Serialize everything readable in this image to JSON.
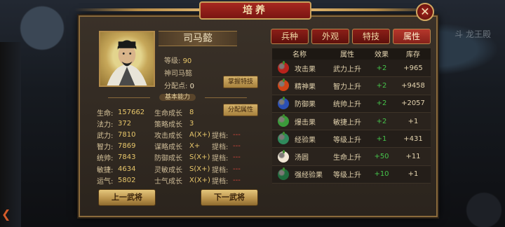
{
  "window": {
    "title": "培养",
    "close_glyph": "✕"
  },
  "background": {
    "corner_text": "斗 龙王殿"
  },
  "general": {
    "name": "司马懿",
    "level_label": "等级:",
    "level_value": "90",
    "title": "神司马懿",
    "points_label": "分配点:",
    "points_value": "0"
  },
  "buttons": {
    "master_skill": "掌握特技",
    "allocate_attr": "分配属性",
    "prev_general": "上一武将",
    "next_general": "下一武将"
  },
  "section_label": "基本能力",
  "stats": [
    {
      "label": "生命:",
      "value": "157662",
      "growth_label": "生命成长",
      "growth_value": "8",
      "boost_label": "",
      "boost_value": ""
    },
    {
      "label": "法力:",
      "value": "372",
      "growth_label": "策略成长",
      "growth_value": "3",
      "boost_label": "",
      "boost_value": ""
    },
    {
      "label": "武力:",
      "value": "7810",
      "growth_label": "攻击成长",
      "growth_value": "A(X+)",
      "boost_label": "提档:",
      "boost_value": "---"
    },
    {
      "label": "智力:",
      "value": "7869",
      "growth_label": "谋略成长",
      "growth_value": "X+",
      "boost_label": "提档:",
      "boost_value": "---"
    },
    {
      "label": "统帅:",
      "value": "7843",
      "growth_label": "防御成长",
      "growth_value": "S(X+)",
      "boost_label": "提档:",
      "boost_value": "---"
    },
    {
      "label": "敏捷:",
      "value": "4634",
      "growth_label": "灵敏成长",
      "growth_value": "S(X+)",
      "boost_label": "提档:",
      "boost_value": "---"
    },
    {
      "label": "运气:",
      "value": "5802",
      "growth_label": "士气成长",
      "growth_value": "X(X+)",
      "boost_label": "提档:",
      "boost_value": "---"
    }
  ],
  "tabs": [
    {
      "label": "兵种",
      "active": false
    },
    {
      "label": "外观",
      "active": false
    },
    {
      "label": "特技",
      "active": false
    },
    {
      "label": "属性",
      "active": true
    }
  ],
  "table": {
    "headers": [
      "名称",
      "属性",
      "效果",
      "库存"
    ],
    "rows": [
      {
        "name": "攻击果",
        "attr": "武力上升",
        "effect": "+2",
        "stock": "+965",
        "icon": "attack-fruit-icon",
        "color": "#b8231c"
      },
      {
        "name": "精神果",
        "attr": "智力上升",
        "effect": "+2",
        "stock": "+9458",
        "icon": "spirit-fruit-icon",
        "color": "#d04416"
      },
      {
        "name": "防御果",
        "attr": "统帅上升",
        "effect": "+2",
        "stock": "+2057",
        "icon": "defense-fruit-icon",
        "color": "#2a4fb5"
      },
      {
        "name": "爆击果",
        "attr": "敏捷上升",
        "effect": "+2",
        "stock": "+1",
        "icon": "crit-fruit-icon",
        "color": "#3b9b3a"
      },
      {
        "name": "经验果",
        "attr": "等级上升",
        "effect": "+1",
        "stock": "+431",
        "icon": "exp-fruit-icon",
        "color": "#2f8a5c"
      },
      {
        "name": "汤圆",
        "attr": "生命上升",
        "effect": "+50",
        "stock": "+11",
        "icon": "tangyuan-icon",
        "color": "#f2e8d6"
      },
      {
        "name": "强经验果",
        "attr": "等级上升",
        "effect": "+10",
        "stock": "+1",
        "icon": "strong-exp-fruit-icon",
        "color": "#1f6b3c"
      }
    ]
  }
}
